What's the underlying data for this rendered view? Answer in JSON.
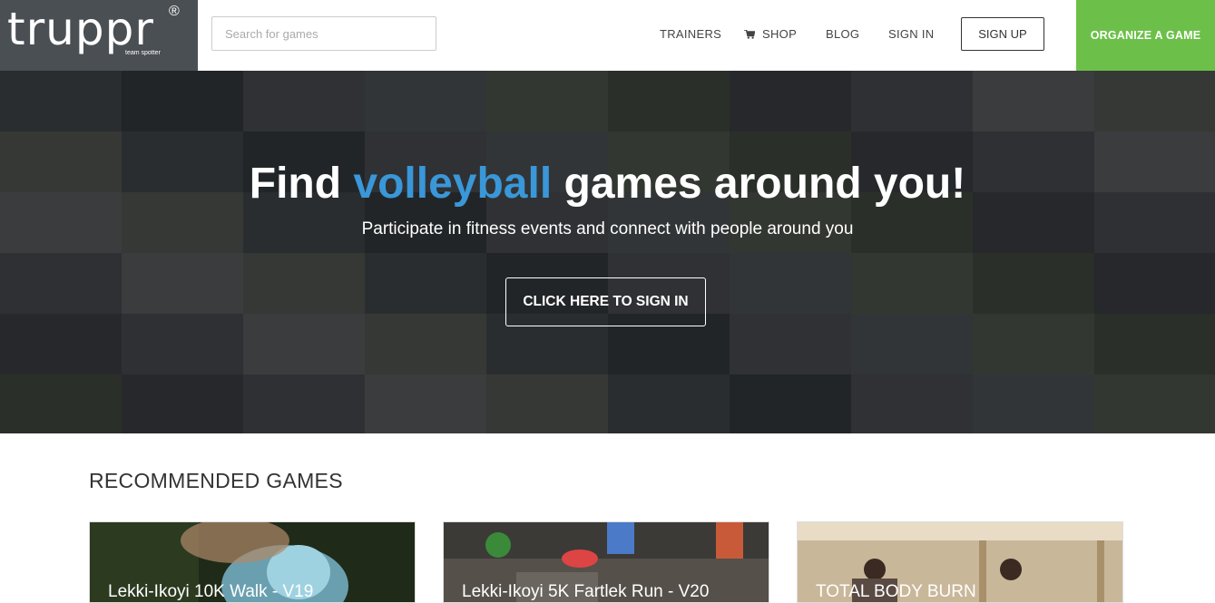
{
  "header": {
    "logo": "truppr",
    "logo_reg": "®",
    "logo_tagline": "team spotter",
    "search_placeholder": "Search for games",
    "nav": {
      "trainers": "TRAINERS",
      "shop": "SHOP",
      "blog": "BLOG",
      "sign_in": "SIGN IN",
      "sign_up": "SIGN UP",
      "organize": "ORGANIZE A GAME"
    }
  },
  "hero": {
    "title_prefix": "Find",
    "title_sport": "volleyball",
    "title_suffix": "games around you!",
    "subtitle": "Participate in fitness events and connect with people around you",
    "cta": "CLICK HERE TO SIGN IN"
  },
  "recommended": {
    "heading": "RECOMMENDED GAMES",
    "cards": [
      {
        "title": "Lekki-Ikoyi 10K Walk - V19"
      },
      {
        "title": "Lekki-Ikoyi 5K Fartlek Run - V20"
      },
      {
        "title": "TOTAL BODY BURN"
      }
    ]
  },
  "colors": {
    "accent_blue": "#3a97d8",
    "organize_green": "#6cc04a",
    "logo_bg": "#4a4f53"
  }
}
